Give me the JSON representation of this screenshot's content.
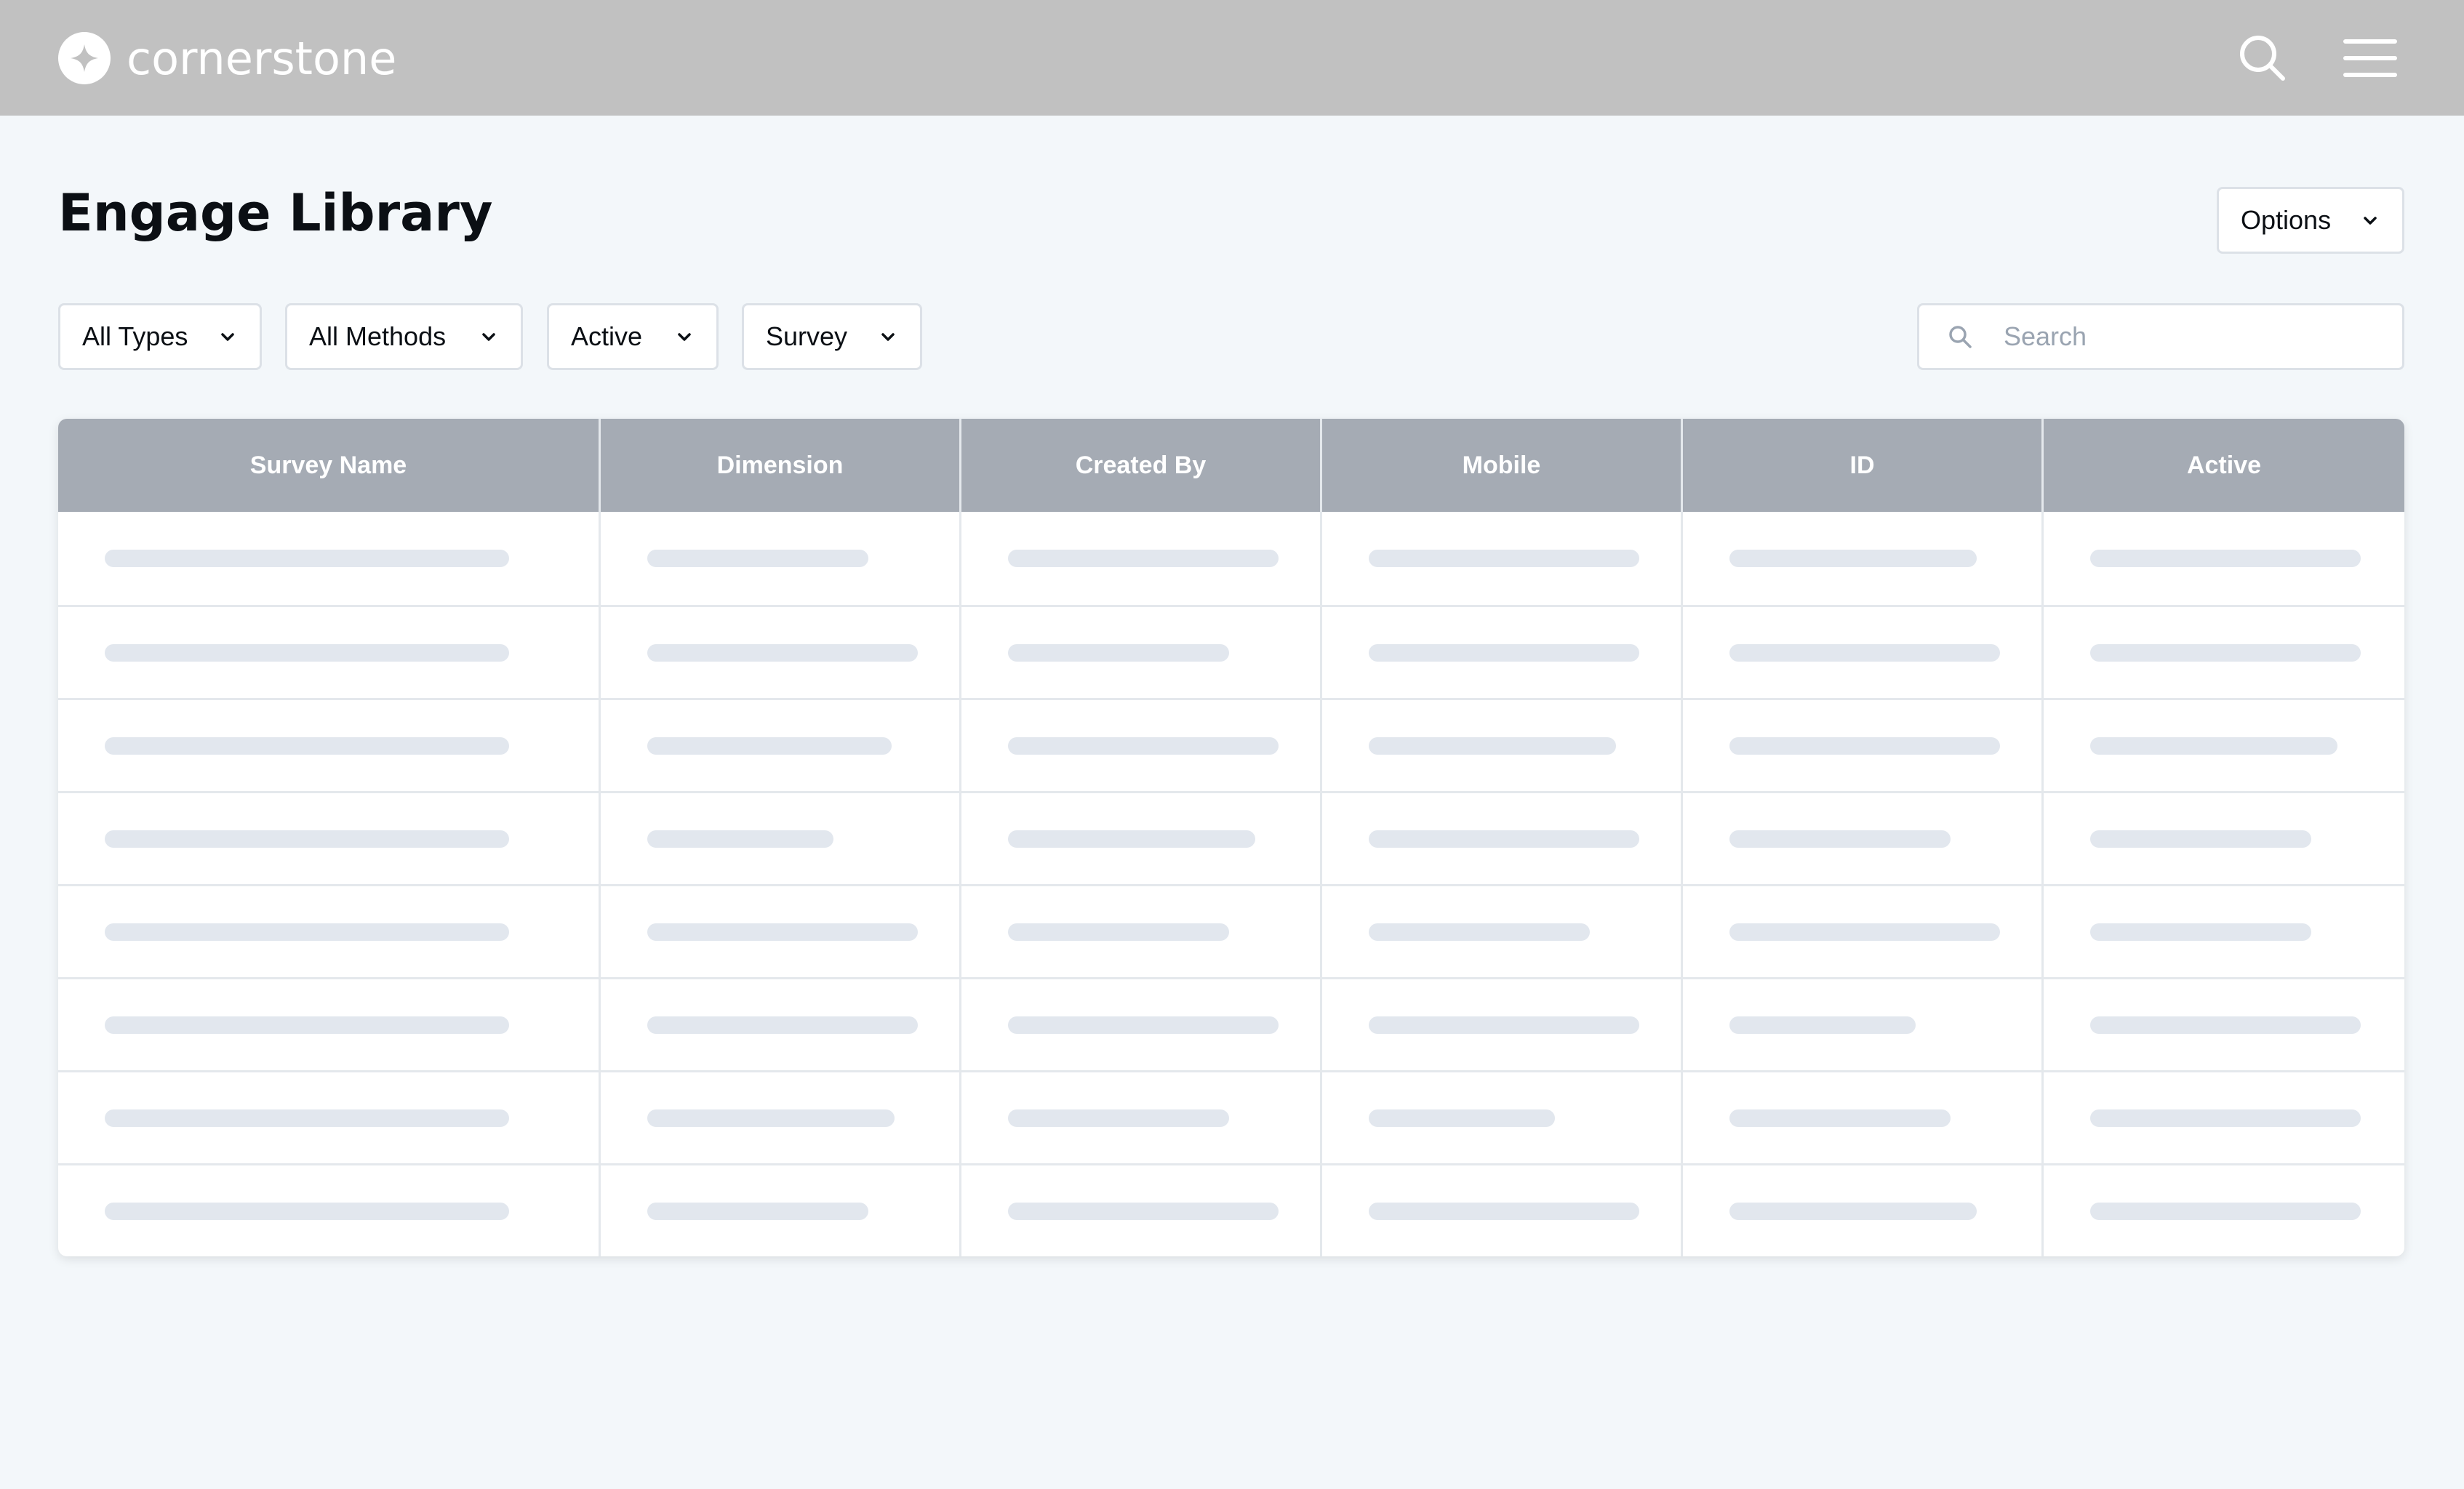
{
  "header": {
    "brand": "cornerstone",
    "icons": {
      "logo": "cornerstone-star-logo",
      "search": "search-icon",
      "menu": "hamburger-menu-icon"
    }
  },
  "page": {
    "title": "Engage Library",
    "options_label": "Options"
  },
  "filters": [
    {
      "label": "All Types"
    },
    {
      "label": "All Methods"
    },
    {
      "label": "Active"
    },
    {
      "label": "Survey"
    }
  ],
  "search": {
    "placeholder": "Search",
    "value": ""
  },
  "table": {
    "columns": [
      "Survey Name",
      "Dimension",
      "Created By",
      "Mobile",
      "ID",
      "Active"
    ],
    "row_count": 8,
    "state": "loading-skeleton"
  },
  "colors": {
    "topbar": "#C1C1C1",
    "page_bg": "#F3F7FA",
    "table_header": "#A5ABB4",
    "skeleton": "#E2E7EE"
  }
}
